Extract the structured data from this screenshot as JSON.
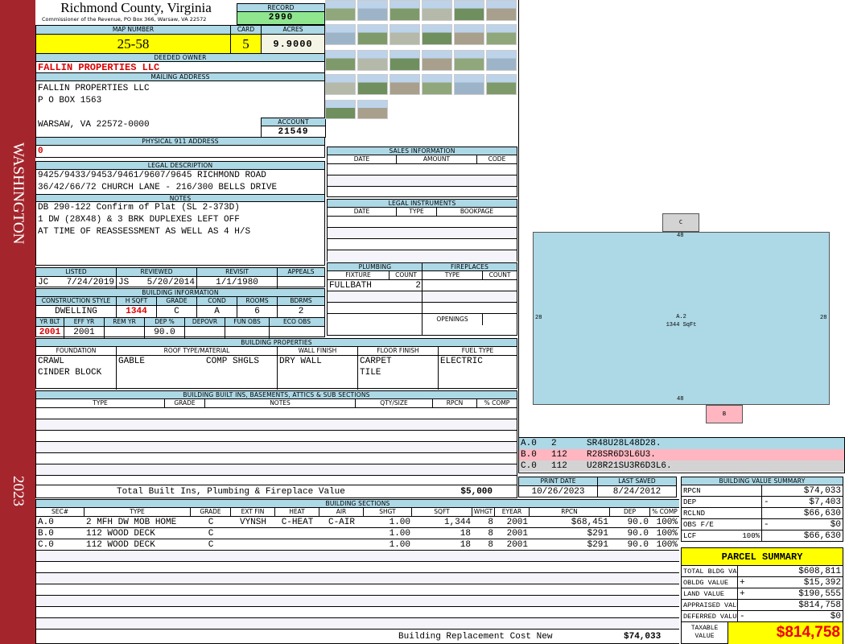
{
  "sidebar": {
    "district": "WASHINGTON",
    "year": "2023"
  },
  "header": {
    "title": "Richmond County, Virginia",
    "subtitle": "Commissioner of the Revenue, PO Box 366, Warsaw, VA 22572",
    "record_label": "RECORD",
    "record": "2990"
  },
  "map": {
    "map_label": "MAP NUMBER",
    "map_number": "25-58",
    "card_label": "CARD",
    "card": "5",
    "acres_label": "ACRES",
    "acres": "9.9000"
  },
  "owner": {
    "label": "DEEDED OWNER",
    "name": "FALLIN PROPERTIES LLC"
  },
  "mailing": {
    "label": "MAILING ADDRESS",
    "line1": "FALLIN PROPERTIES LLC",
    "line2": "P O BOX 1563",
    "line3": "WARSAW, VA 22572-0000",
    "account_label": "ACCOUNT",
    "account": "21549"
  },
  "physical": {
    "label": "PHYSICAL 911 ADDRESS",
    "value": "0"
  },
  "legal": {
    "label": "LEGAL DESCRIPTION",
    "line1": "9425/9433/9453/9461/9607/9645 RICHMOND ROAD",
    "line2": "36/42/66/72 CHURCH LANE - 216/300 BELLS DRIVE"
  },
  "notes": {
    "label": "NOTES",
    "line1": "DB 290-122 Confirm of Plat (SL 2-373D)",
    "line2": "1 DW (28X48) & 3 BRK DUPLEXES LEFT OFF",
    "line3": "AT TIME OF REASSESSMENT AS WELL AS 4 H/S"
  },
  "listing": {
    "listed_label": "LISTED",
    "listed_by": "JC",
    "listed_date": "7/24/2019",
    "reviewed_label": "REVIEWED",
    "reviewed_by": "JS",
    "reviewed_date": "5/20/2014",
    "revisit_label": "REVISIT",
    "revisit": "1/1/1980",
    "appeals_label": "APPEALS"
  },
  "building_info": {
    "label": "BUILDING INFORMATION",
    "h1": [
      "CONSTRUCTION STYLE",
      "H SQFT",
      "GRADE",
      "COND",
      "ROOMS",
      "BDRMS"
    ],
    "v1": [
      "DWELLING",
      "1344",
      "C",
      "A",
      "6",
      "2"
    ],
    "h2": [
      "YR BLT",
      "EFF YR",
      "REM YR",
      "DEP %",
      "DEPOVR",
      "FUN OBS",
      "ECO OBS"
    ],
    "v2": [
      "2001",
      "2001",
      "",
      "90.0",
      "",
      "",
      ""
    ]
  },
  "building_props": {
    "label": "BUILDING PROPERTIES",
    "headers": [
      "FOUNDATION",
      "ROOF TYPE/MATERIAL",
      "WALL FINISH",
      "FLOOR FINISH",
      "FUEL TYPE"
    ],
    "foundation": [
      "CRAWL",
      "CINDER BLOCK"
    ],
    "roof_type": "GABLE",
    "roof_material": "COMP SHGLS",
    "wall": "DRY WALL",
    "floor": [
      "CARPET",
      "TILE"
    ],
    "fuel": "ELECTRIC"
  },
  "built_ins": {
    "label": "BUILDING BUILT INS, BASEMENTS, ATTICS & SUB SECTIONS",
    "headers": [
      "TYPE",
      "GRADE",
      "NOTES",
      "QTY/SIZE",
      "RPCN",
      "% COMP"
    ],
    "total_label": "Total Built Ins, Plumbing & Fireplace Value",
    "total": "$5,000"
  },
  "sales": {
    "label": "SALES INFORMATION",
    "headers": [
      "DATE",
      "AMOUNT",
      "CODE"
    ]
  },
  "instruments": {
    "label": "LEGAL INSTRUMENTS",
    "headers": [
      "DATE",
      "TYPE",
      "BOOKPAGE"
    ]
  },
  "plumbing": {
    "label": "PLUMBING",
    "headers": [
      "FIXTURE",
      "COUNT"
    ],
    "rows": [
      {
        "fixture": "FULLBATH",
        "count": "2"
      }
    ]
  },
  "fireplaces": {
    "label": "FIREPLACES",
    "headers": [
      "TYPE",
      "COUNT"
    ],
    "openings_label": "OPENINGS"
  },
  "sketch": {
    "main_label": "A.2",
    "main_area": "1344 SqFt",
    "top": "48",
    "bottom": "48",
    "left": "28",
    "right": "28",
    "c_label": "C",
    "b_label": "B",
    "sections": [
      {
        "id": "A.0",
        "code": "2",
        "path": "SR48U28L48D28.",
        "color": "#add8e6"
      },
      {
        "id": "B.0",
        "code": "112",
        "path": "R28SR6D3L6U3.",
        "color": "#ffb6c1"
      },
      {
        "id": "C.0",
        "code": "112",
        "path": "U28R21SU3R6D3L6.",
        "color": "#d3d3d3"
      }
    ]
  },
  "dates": {
    "print_label": "PRINT DATE",
    "print_date": "10/26/2023",
    "saved_label": "LAST SAVED",
    "last_saved": "8/24/2012"
  },
  "sections": {
    "label": "BUILDING SECTIONS",
    "headers": [
      "SEC#",
      "TYPE",
      "GRADE",
      "EXT FIN",
      "HEAT",
      "AIR",
      "SHGT",
      "SQFT",
      "WHGT",
      "EYEAR",
      "RPCN",
      "DEP",
      "% COMP"
    ],
    "rows": [
      [
        "A.0",
        "2 MFH DW MOB HOME",
        "C",
        "VYNSH",
        "C-HEAT",
        "C-AIR",
        "1.00",
        "1,344",
        "8",
        "2001",
        "$68,451",
        "90.0",
        "100%"
      ],
      [
        "B.0",
        "112 WOOD DECK",
        "C",
        "",
        "",
        "",
        "1.00",
        "18",
        "8",
        "2001",
        "$291",
        "90.0",
        "100%"
      ],
      [
        "C.0",
        "112 WOOD DECK",
        "C",
        "",
        "",
        "",
        "1.00",
        "18",
        "8",
        "2001",
        "$291",
        "90.0",
        "100%"
      ]
    ],
    "replacement_label": "Building Replacement Cost New",
    "replacement": "$74,033"
  },
  "value_summary": {
    "label": "BUILDING VALUE SUMMARY",
    "rows": [
      {
        "label": "RPCN",
        "pct": "",
        "sign": "",
        "value": "$74,033"
      },
      {
        "label": "DEP",
        "pct": "",
        "sign": "-",
        "value": "$7,403"
      },
      {
        "label": "RCLND",
        "pct": "",
        "sign": "",
        "value": "$66,630"
      },
      {
        "label": "OBS F/E",
        "pct": "",
        "sign": "-",
        "value": "$0"
      },
      {
        "label": "LCF",
        "pct": "100%",
        "sign": "",
        "value": "$66,630"
      }
    ]
  },
  "parcel": {
    "label": "PARCEL SUMMARY",
    "rows": [
      {
        "label": "TOTAL BLDG VALUE",
        "sign": "",
        "value": "$608,811"
      },
      {
        "label": "OBLDG VALUE",
        "sign": "+",
        "value": "$15,392"
      },
      {
        "label": "LAND VALUE",
        "sign": "+",
        "value": "$190,555"
      },
      {
        "label": "APPRAISED VALUE",
        "sign": "",
        "value": "$814,758"
      },
      {
        "label": "DEFERRED VALUE",
        "sign": "-",
        "value": "$0"
      }
    ],
    "taxable_label": "TAXABLE VALUE",
    "taxable": "$814,758"
  }
}
